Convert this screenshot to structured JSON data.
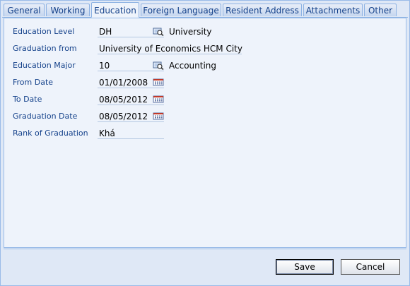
{
  "tabs": [
    {
      "label": "General",
      "active": false
    },
    {
      "label": "Working",
      "active": false
    },
    {
      "label": "Education",
      "active": true
    },
    {
      "label": "Foreign Language",
      "active": false
    },
    {
      "label": "Resident Address",
      "active": false
    },
    {
      "label": "Attachments",
      "active": false
    },
    {
      "label": "Other",
      "active": false
    }
  ],
  "form": {
    "education_level": {
      "label": "Education Level",
      "value": "DH",
      "icon": "lookup-icon",
      "description": "University"
    },
    "graduation_from": {
      "label": "Graduation from",
      "value": "University of Economics HCM City"
    },
    "education_major": {
      "label": "Education Major",
      "value": "10",
      "icon": "lookup-icon",
      "description": "Accounting"
    },
    "from_date": {
      "label": "From Date",
      "value": "01/01/2008",
      "icon": "calendar-icon"
    },
    "to_date": {
      "label": "To Date",
      "value": "08/05/2012",
      "icon": "calendar-icon"
    },
    "graduation_date": {
      "label": "Graduation Date",
      "value": "08/05/2012",
      "icon": "calendar-icon"
    },
    "rank_of_graduation": {
      "label": "Rank of Graduation",
      "value": "Khá"
    }
  },
  "buttons": {
    "save": "Save",
    "cancel": "Cancel"
  },
  "colors": {
    "panel": "#eef3fb",
    "window": "#dfe8f6",
    "label": "#15428b",
    "border": "#99bbe8"
  }
}
